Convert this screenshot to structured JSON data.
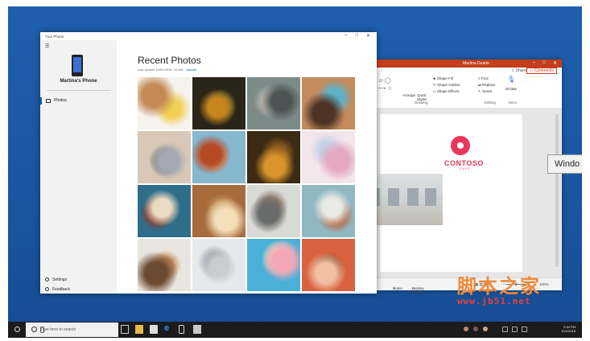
{
  "your_phone": {
    "window_title": "Your Phone",
    "phone_name": "Martina's Phone",
    "nav_photos": "Photos",
    "nav_settings": "Settings",
    "nav_feedback": "Feedback",
    "heading": "Recent Photos",
    "last_synced": "Last synced 10/01/2018, 10 AM",
    "update_link": "Update",
    "photos": [
      {
        "subject": "bulldog puppy",
        "colors": [
          "#f6f2ee",
          "#c48a54",
          "#f1d055"
        ]
      },
      {
        "subject": "flowers in vase",
        "colors": [
          "#2b2519",
          "#c7851e",
          "#5b6b2c"
        ]
      },
      {
        "subject": "sneakers on pavement",
        "colors": [
          "#7d8a8a",
          "#4b5452",
          "#b8b6ae"
        ]
      },
      {
        "subject": "smiling friends selfie",
        "colors": [
          "#c48b5d",
          "#4f3326",
          "#5fb1c8"
        ]
      },
      {
        "subject": "beach at sunset",
        "colors": [
          "#d9c8b7",
          "#a3a9b3",
          "#7e6e60"
        ]
      },
      {
        "subject": "food flat lay",
        "colors": [
          "#86b8cf",
          "#b54a25",
          "#e9c38d"
        ]
      },
      {
        "subject": "bakery sign",
        "colors": [
          "#3b2a14",
          "#d9942b",
          "#8a5a1f"
        ]
      },
      {
        "subject": "macarons",
        "colors": [
          "#f2e6ea",
          "#e4a9c1",
          "#c6d2e6"
        ]
      },
      {
        "subject": "cheesecake",
        "colors": [
          "#2f6e8a",
          "#eadbc2",
          "#8c3a2c"
        ]
      },
      {
        "subject": "cupcakes",
        "colors": [
          "#a86b3b",
          "#f5dfb9",
          "#c79a5c"
        ]
      },
      {
        "subject": "cafe storefront",
        "colors": [
          "#d9d9d6",
          "#6a6c6b",
          "#8d7d6b"
        ]
      },
      {
        "subject": "cafe interior",
        "colors": [
          "#8fb8c2",
          "#e8eae6",
          "#b86b48"
        ]
      },
      {
        "subject": "cookies",
        "colors": [
          "#e9e6e0",
          "#6b4a31",
          "#c58e5a"
        ]
      },
      {
        "subject": "baking ingredients",
        "colors": [
          "#e7e8ea",
          "#c9cdd2",
          "#a3a7ad"
        ]
      },
      {
        "subject": "donut on blue",
        "colors": [
          "#4ab0d8",
          "#f2a6b6",
          "#f6e4b8"
        ]
      },
      {
        "subject": "donut assortment",
        "colors": [
          "#d8623f",
          "#f1c0a4",
          "#7b4a2c"
        ]
      }
    ]
  },
  "powerpoint": {
    "window_title": "Martina Duarte",
    "share": "Share",
    "comments": "Comments",
    "ribbon": {
      "arrange": "Arrange",
      "quick_styles": "Quick Styles",
      "shape_fill": "Shape Fill",
      "shape_outline": "Shape Outline",
      "shape_effects": "Shape Effects",
      "find": "Find",
      "replace": "Replace",
      "select": "Select",
      "dictate": "Dictate",
      "group_drawing": "Drawing",
      "group_editing": "Editing",
      "group_voice": "Voice"
    },
    "slide": {
      "logo_text": "CONTOSO",
      "logo_sub": "CAFE"
    },
    "status": {
      "notes": "Notes",
      "display_settings": "Display Settings",
      "zoom": "100%"
    }
  },
  "tooltip": "Windo",
  "taskbar": {
    "search_placeholder": "Type here to search",
    "time": "2:30 PM",
    "date": "10/1/2018"
  },
  "watermark": {
    "line1": "脚本之家",
    "line2": "www.jb51.net"
  }
}
